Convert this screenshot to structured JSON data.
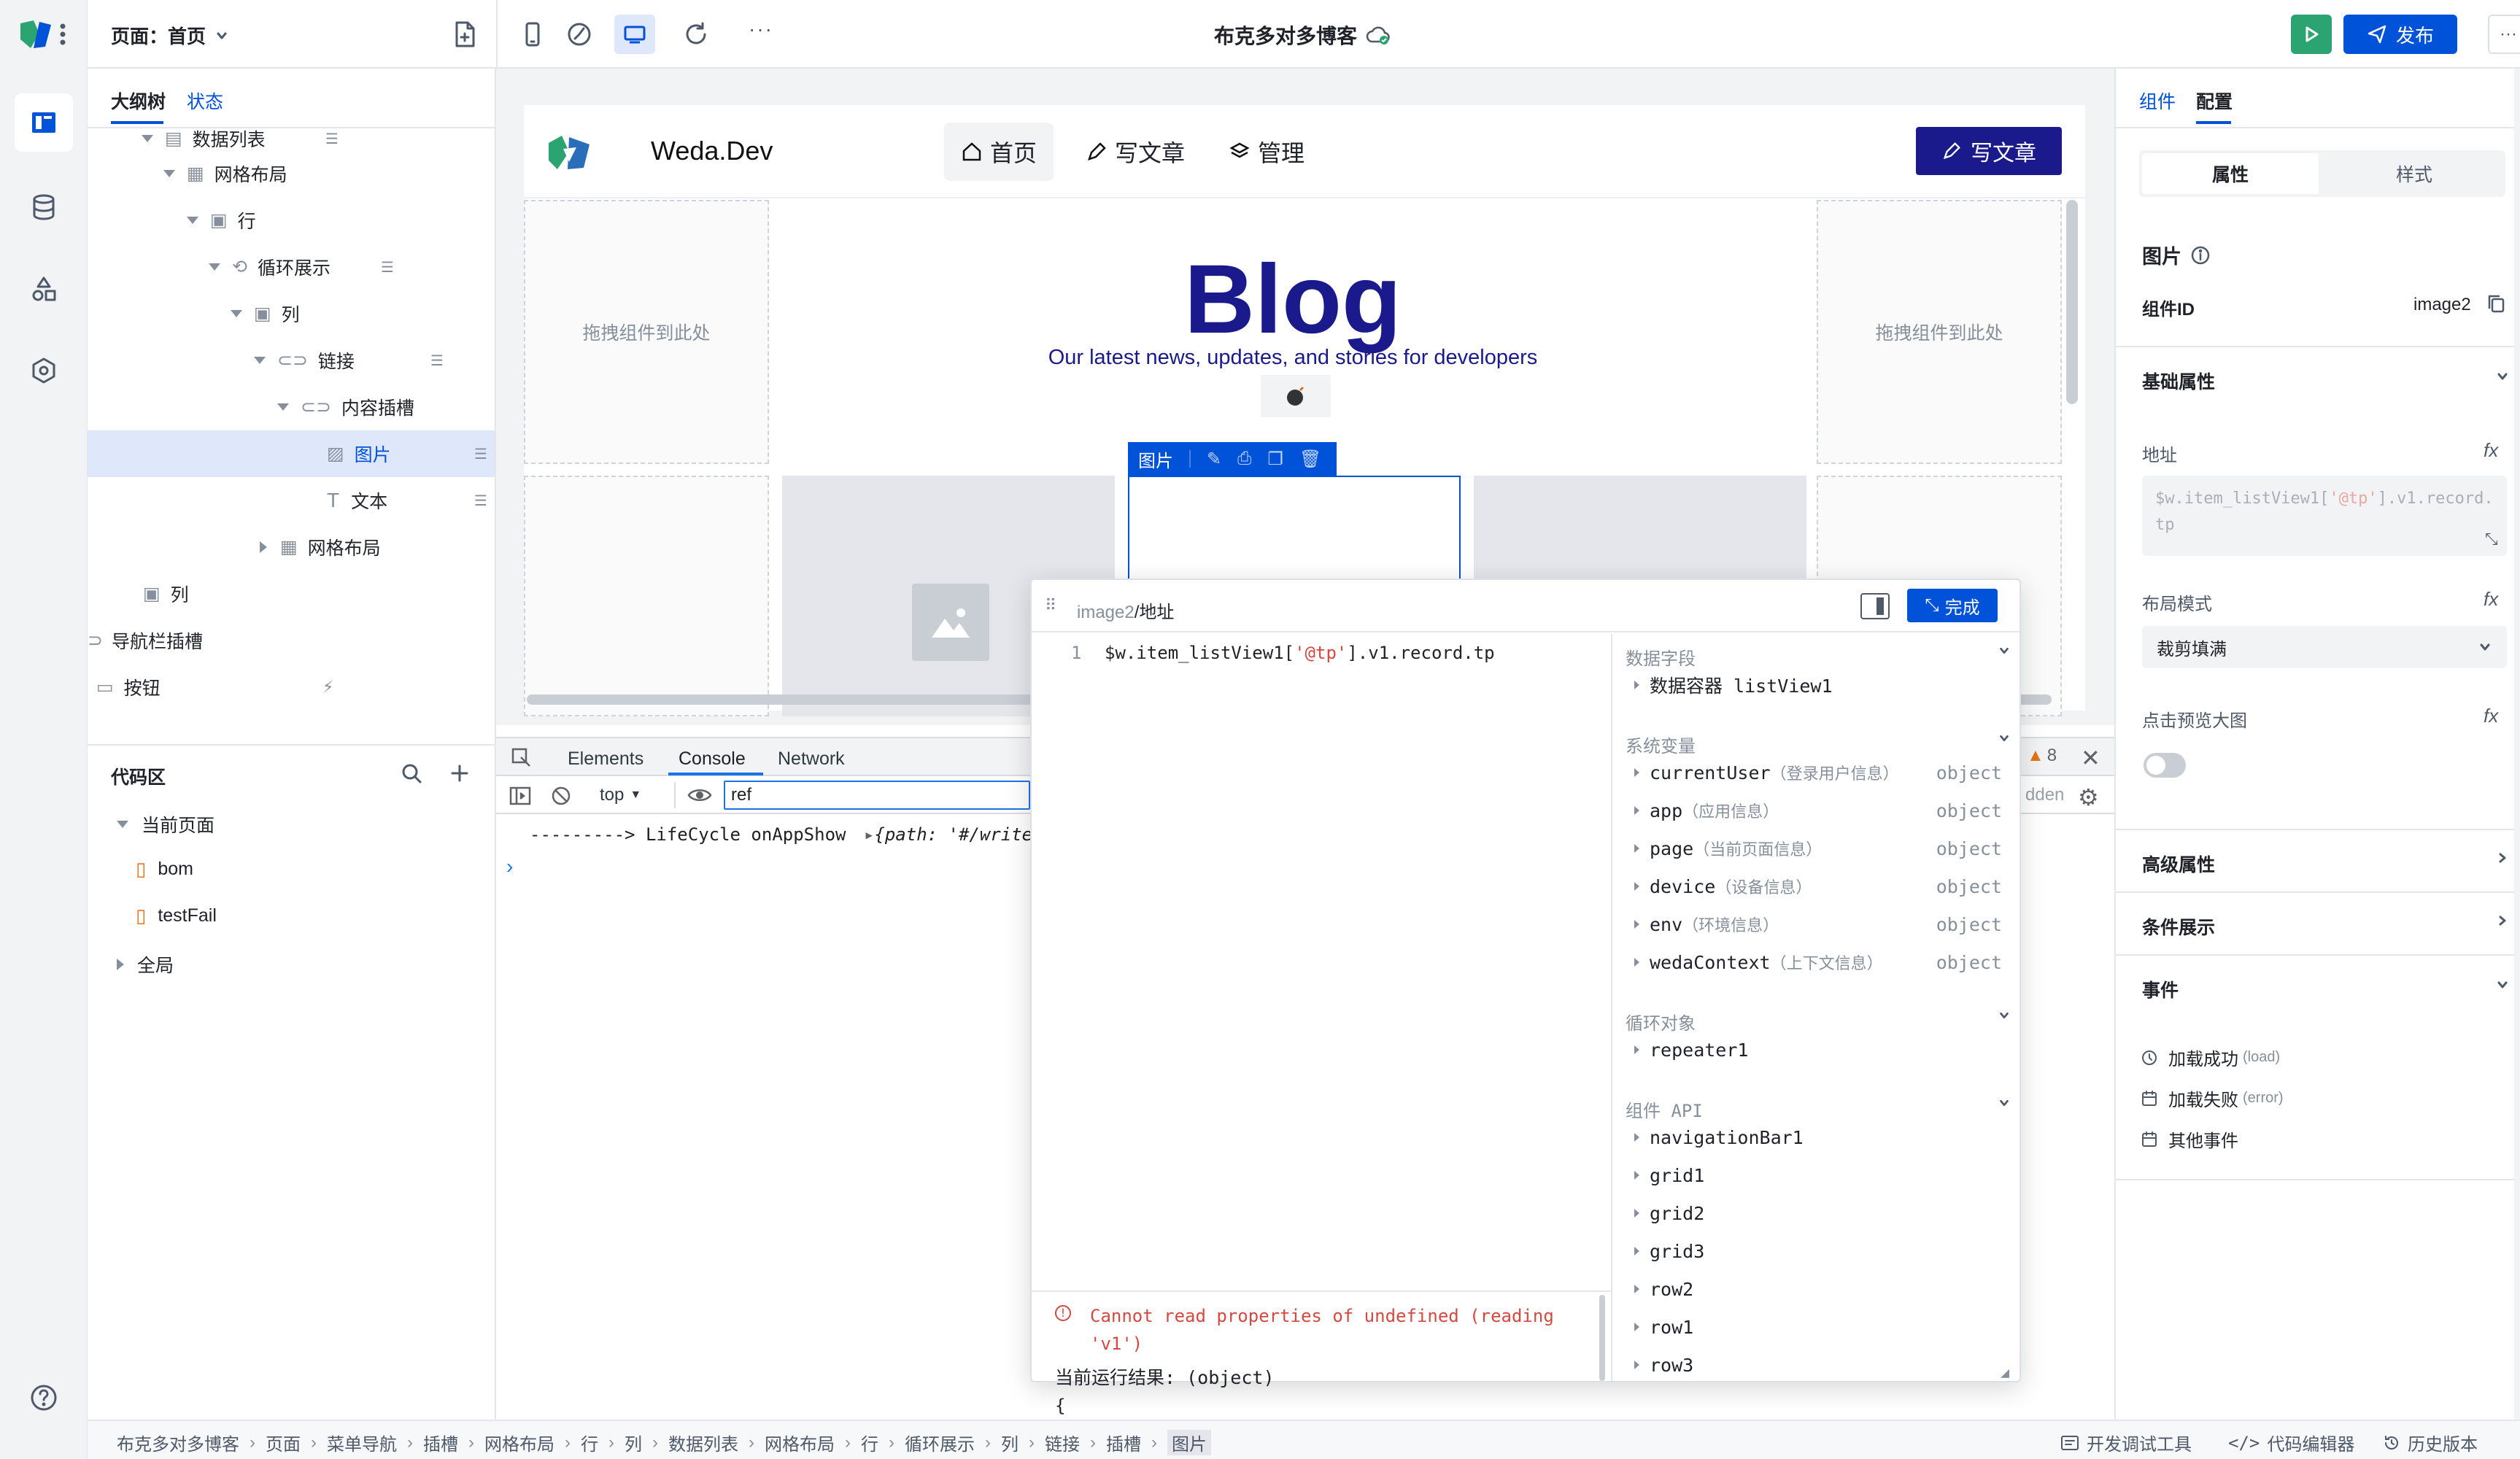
{
  "topbar": {
    "page_selector": "页面：首页",
    "app_title": "布克多对多博客",
    "publish_label": "发布",
    "more_label": "···"
  },
  "left_tabs": {
    "outline": "大纲树",
    "state": "状态"
  },
  "outline": [
    {
      "label": "数据列表"
    },
    {
      "label": "网格布局"
    },
    {
      "label": "行"
    },
    {
      "label": "循环展示"
    },
    {
      "label": "列"
    },
    {
      "label": "链接"
    },
    {
      "label": "内容插槽"
    },
    {
      "label": "图片"
    },
    {
      "label": "文本"
    },
    {
      "label": "网格布局"
    },
    {
      "label": "列"
    },
    {
      "label": "导航栏插槽"
    },
    {
      "label": "按钮"
    }
  ],
  "code_area": {
    "title": "代码区",
    "current_page": "当前页面",
    "files": [
      "bom",
      "testFail"
    ],
    "global": "全局"
  },
  "preview": {
    "logo_text": "Weda.Dev",
    "nav": [
      "首页",
      "写文章",
      "管理"
    ],
    "write_button": "写文章",
    "hero_title": "Blog",
    "hero_subtitle": "Our latest news, updates, and stories for developers",
    "drop_hint_left": "拖拽组件到此处",
    "drop_hint_right": "拖拽组件到此处",
    "selected_tag": "图片"
  },
  "devtools": {
    "tabs": [
      "Elements",
      "Console",
      "Network"
    ],
    "context": "top",
    "filter_value": "ref",
    "log_line_prefix": "---------> LifeCycle onAppShow",
    "log_line_obj": "{path: '#/write",
    "warning_count": "8",
    "hidden_fragment": "dden"
  },
  "expr_editor": {
    "path_prefix": "image2",
    "path_field": "/地址",
    "done_label": "完成",
    "line_number": "1",
    "code_a": "$w.item_listView1[",
    "code_b": "'@tp'",
    "code_c": "].v1.record.tp",
    "error": "Cannot read properties of undefined (reading 'v1')",
    "result_label": "当前运行结果: (object)",
    "result_brace": "{",
    "sections": {
      "data_fields": "数据字段",
      "data_container": "数据容器 listView1",
      "sys_vars": "系统变量",
      "loop_obj": "循环对象",
      "repeater": "repeater1",
      "component_api": "组件 API"
    },
    "sys_vars": [
      {
        "name": "currentUser",
        "hint": "（登录用户信息）",
        "type": "object"
      },
      {
        "name": "app",
        "hint": "（应用信息）",
        "type": "object"
      },
      {
        "name": "page",
        "hint": "（当前页面信息）",
        "type": "object"
      },
      {
        "name": "device",
        "hint": "（设备信息）",
        "type": "object"
      },
      {
        "name": "env",
        "hint": "（环境信息）",
        "type": "object"
      },
      {
        "name": "wedaContext",
        "hint": "（上下文信息）",
        "type": "object"
      }
    ],
    "apis": [
      "navigationBar1",
      "grid1",
      "grid2",
      "grid3",
      "row2",
      "row1",
      "row3"
    ]
  },
  "right_panel": {
    "tabs": [
      "组件",
      "配置"
    ],
    "seg": [
      "属性",
      "样式"
    ],
    "component_title": "图片",
    "component_id_label": "组件ID",
    "component_id": "image2",
    "basic_props": "基础属性",
    "address_label": "地址",
    "address_a": "$w.item_listView1[",
    "address_b": "'@tp'",
    "address_c": "].v1.record.tp",
    "layout_mode_label": "布局模式",
    "layout_mode_value": "裁剪填满",
    "preview_label": "点击预览大图",
    "advanced": "高级属性",
    "conditional": "条件展示",
    "events": "事件",
    "event_items": [
      {
        "label": "加载成功",
        "key": "(load)"
      },
      {
        "label": "加载失败",
        "key": "(error)"
      },
      {
        "label": "其他事件",
        "key": ""
      }
    ]
  },
  "breadcrumb": [
    "布克多对多博客",
    "页面",
    "菜单导航",
    "插槽",
    "网格布局",
    "行",
    "列",
    "数据列表",
    "网格布局",
    "行",
    "循环展示",
    "列",
    "链接",
    "插槽",
    "图片"
  ],
  "status_tools": [
    "开发调试工具",
    "代码编辑器",
    "历史版本"
  ],
  "colors": {
    "accent": "#0052d9",
    "publish_green": "#2ba471",
    "navy": "#1a1a8c",
    "error": "#d54941"
  }
}
